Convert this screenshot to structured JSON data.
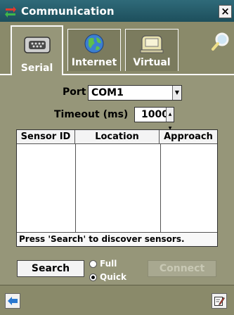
{
  "window": {
    "title": "Communication",
    "close_label": "×",
    "title_icon": "arrows-exchange-icon"
  },
  "tabs": [
    {
      "label": "Serial",
      "icon": "serial-port-icon",
      "active": true
    },
    {
      "label": "Internet",
      "icon": "globe-icon",
      "active": false
    },
    {
      "label": "Virtual",
      "icon": "virtual-device-icon",
      "active": false
    }
  ],
  "search_icon": "magnifier-icon",
  "port": {
    "label": "Port",
    "value": "COM1"
  },
  "timeout": {
    "label": "Timeout (ms)",
    "value": "1000"
  },
  "sensor_table": {
    "columns": [
      "Sensor ID",
      "Location",
      "Approach"
    ],
    "rows": [],
    "status": "Press 'Search' to discover sensors."
  },
  "search_button": "Search",
  "mode_options": [
    {
      "label": "Full",
      "checked": false
    },
    {
      "label": "Quick",
      "checked": true
    }
  ],
  "connect_button": "Connect",
  "command_bar": {
    "left_icon": "back-arrow-icon",
    "right_icon": "edit-note-icon"
  },
  "colors": {
    "title_bar": "#1d4f5c",
    "panel": "#969679",
    "tab_strip": "#8a8a6a"
  }
}
